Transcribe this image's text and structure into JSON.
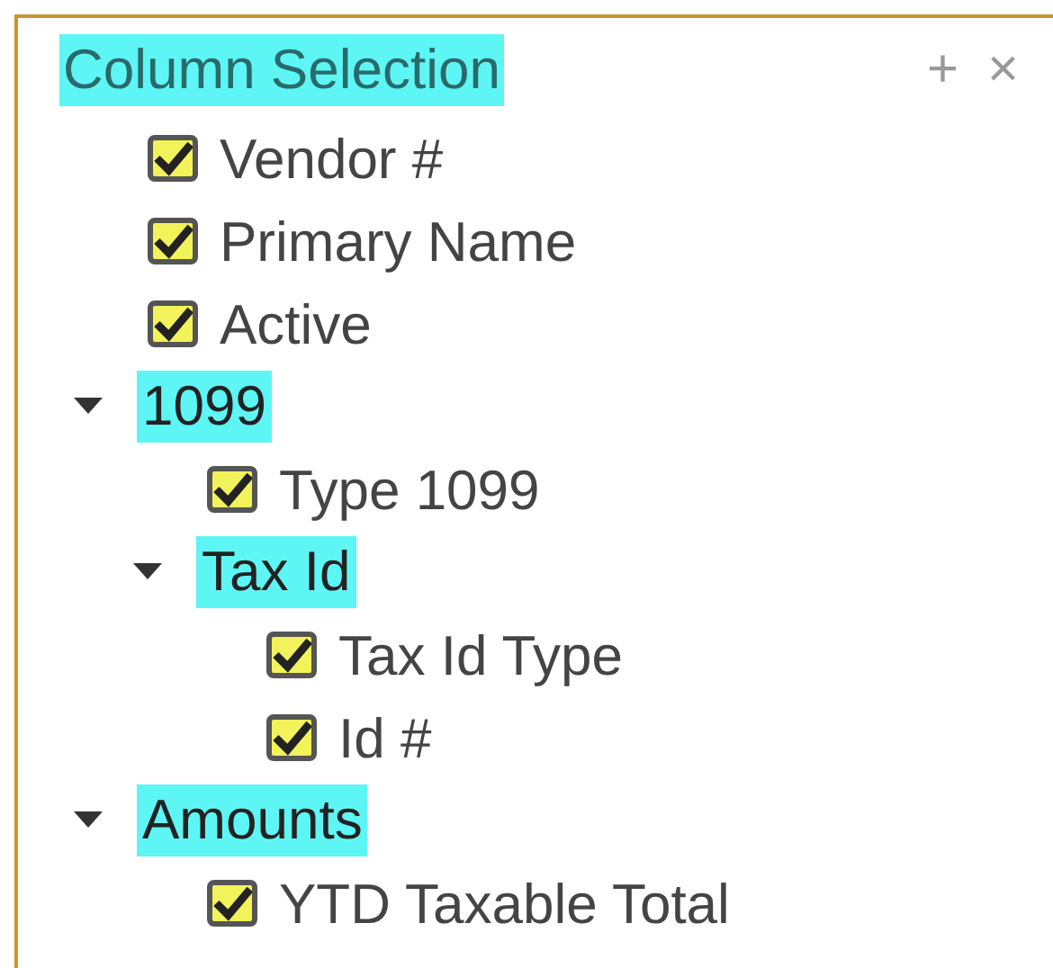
{
  "panel": {
    "title": "Column Selection",
    "actions": [
      "+",
      "×"
    ]
  },
  "tree": [
    {
      "kind": "field",
      "label": "Vendor #",
      "checked": true
    },
    {
      "kind": "field",
      "label": "Primary Name",
      "checked": true
    },
    {
      "kind": "field",
      "label": "Active",
      "checked": true
    },
    {
      "kind": "group",
      "label": "1099",
      "expanded": true,
      "children": [
        {
          "kind": "field",
          "label": "Type 1099",
          "checked": true
        },
        {
          "kind": "group",
          "label": "Tax Id",
          "expanded": true,
          "children": [
            {
              "kind": "field",
              "label": "Tax Id Type",
              "checked": true
            },
            {
              "kind": "field",
              "label": "Id #",
              "checked": true
            }
          ]
        }
      ]
    },
    {
      "kind": "group",
      "label": "Amounts",
      "expanded": true,
      "children": [
        {
          "kind": "field",
          "label": "YTD Taxable Total",
          "checked": true
        }
      ]
    }
  ]
}
